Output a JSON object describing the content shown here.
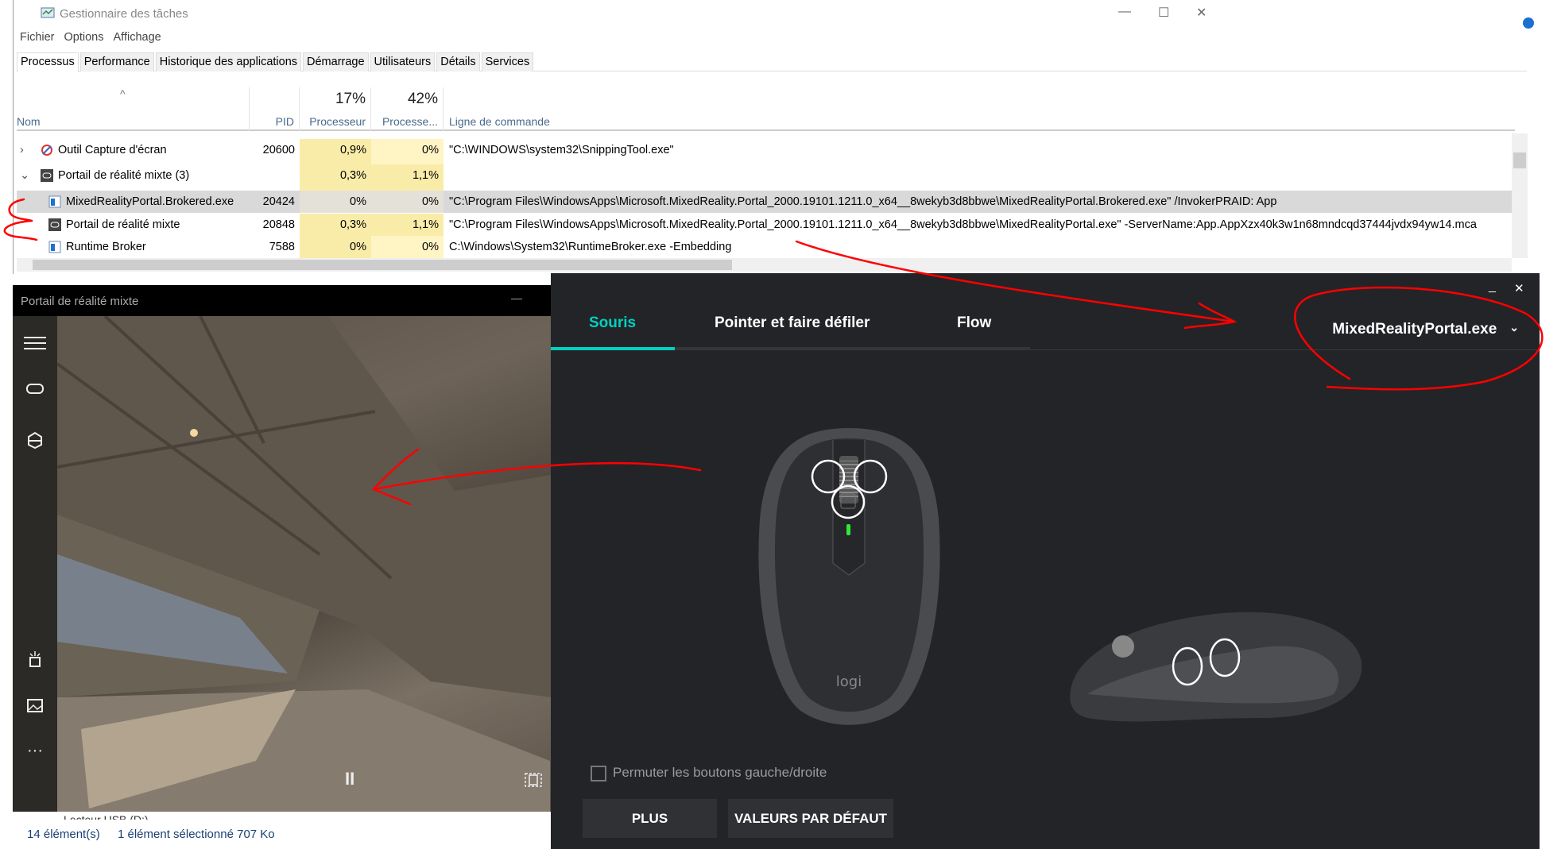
{
  "task_manager": {
    "title": "Gestionnaire des tâches",
    "window_controls": {
      "minimize": "—",
      "maximize": "☐",
      "close": "✕"
    },
    "menu": [
      "Fichier",
      "Options",
      "Affichage"
    ],
    "tabs": [
      "Processus",
      "Performance",
      "Historique des applications",
      "Démarrage",
      "Utilisateurs",
      "Détails",
      "Services"
    ],
    "active_tab": "Processus",
    "columns": {
      "name": "Nom",
      "pid": "PID",
      "cpu_pct": "17%",
      "cpu": "Processeur",
      "gpu_pct": "42%",
      "gpu": "Processe...",
      "cmd": "Ligne de commande"
    },
    "rows": [
      {
        "expander": "›",
        "icon": "snipping-tool-icon",
        "name": "Outil Capture d'écran",
        "pid": "20600",
        "cpu": "0,9%",
        "gpu": "0%",
        "cmd": "\"C:\\WINDOWS\\system32\\SnippingTool.exe\""
      },
      {
        "expander": "⌄",
        "icon": "mixed-reality-icon",
        "name": "Portail de réalité mixte (3)",
        "pid": "",
        "cpu": "0,3%",
        "gpu": "1,1%",
        "cmd": ""
      },
      {
        "icon": "app-window-icon",
        "name": "MixedRealityPortal.Brokered.exe",
        "pid": "20424",
        "cpu": "0%",
        "gpu": "0%",
        "cmd": "\"C:\\Program Files\\WindowsApps\\Microsoft.MixedReality.Portal_2000.19101.1211.0_x64__8wekyb3d8bbwe\\MixedRealityPortal.Brokered.exe\" /InvokerPRAID: App",
        "selected": true
      },
      {
        "icon": "mixed-reality-icon",
        "name": "Portail de réalité mixte",
        "pid": "20848",
        "cpu": "0,3%",
        "gpu": "1,1%",
        "cmd": "\"C:\\Program Files\\WindowsApps\\Microsoft.MixedReality.Portal_2000.19101.1211.0_x64__8wekyb3d8bbwe\\MixedRealityPortal.exe\" -ServerName:App.AppXzx40k3w1n68mndcqd37444jvdx94yw14.mca"
      },
      {
        "icon": "app-window-icon",
        "name": "Runtime Broker",
        "pid": "7588",
        "cpu": "0%",
        "gpu": "0%",
        "cmd": "C:\\Windows\\System32\\RuntimeBroker.exe -Embedding"
      }
    ]
  },
  "mixed_reality": {
    "title": "Portail de réalité mixte",
    "minimize": "—",
    "sidebar_icons": [
      "menu-icon",
      "headset-icon",
      "environment-icon",
      "whats-new-icon",
      "photos-icon",
      "more-icon"
    ],
    "more": "···",
    "pause": "II"
  },
  "explorer_status": {
    "drive": "Lecteur USB (D:)",
    "count": "14 élément(s)",
    "selection": "1 élément sélectionné  707 Ko"
  },
  "logitech": {
    "window_controls": {
      "minimize": "_",
      "close": "✕"
    },
    "tabs": [
      "Souris",
      "Pointer et faire défiler",
      "Flow"
    ],
    "active_tab": "Souris",
    "app_selector": "MixedRealityPortal.exe",
    "chevron": "⌄",
    "mouse_logo": "logi",
    "swap_buttons_label": "Permuter les boutons gauche/droite",
    "swap_buttons_checked": false,
    "buttons": {
      "more": "PLUS",
      "defaults": "VALEURS PAR DÉFAUT"
    },
    "accent": "#00d1c1"
  },
  "annotation_color": "#ff0000"
}
